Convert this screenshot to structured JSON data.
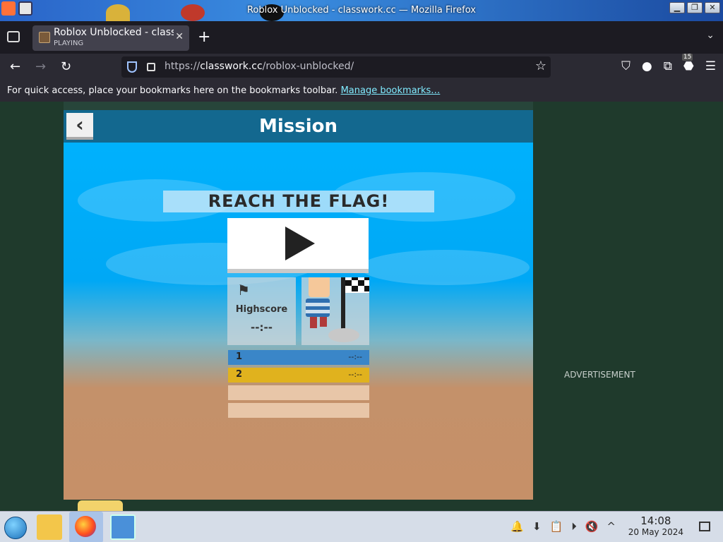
{
  "window": {
    "title": "Roblox Unblocked - classwork.cc — Mozilla Firefox",
    "controls": [
      "minimize",
      "maximize",
      "close"
    ]
  },
  "tabs": [
    {
      "title": "Roblox Unblocked - class",
      "subtitle": "PLAYING"
    }
  ],
  "navbar": {
    "url_prefix": "https://",
    "url_domain": "classwork.cc",
    "url_path": "/roblox-unblocked/",
    "extension_badge": "15"
  },
  "bookmarks_bar": {
    "message": "For quick access, place your bookmarks here on the bookmarks toolbar.",
    "link": "Manage bookmarks…"
  },
  "game": {
    "header_title": "Mission",
    "goal": "REACH THE FLAG!",
    "highscore_label": "Highscore",
    "highscore_value": "--:--",
    "leaderboard": [
      {
        "rank": "1",
        "time": "--:--",
        "color": "#3a86c8"
      },
      {
        "rank": "2",
        "time": "--:--",
        "color": "#e0b21e"
      },
      {
        "rank": "",
        "time": "",
        "color": "#e8c6a8"
      },
      {
        "rank": "",
        "time": "",
        "color": "#e8c6a8"
      }
    ]
  },
  "advertisement_label": "ADVERTISEMENT",
  "taskbar": {
    "time": "14:08",
    "date": "20 May 2024"
  }
}
